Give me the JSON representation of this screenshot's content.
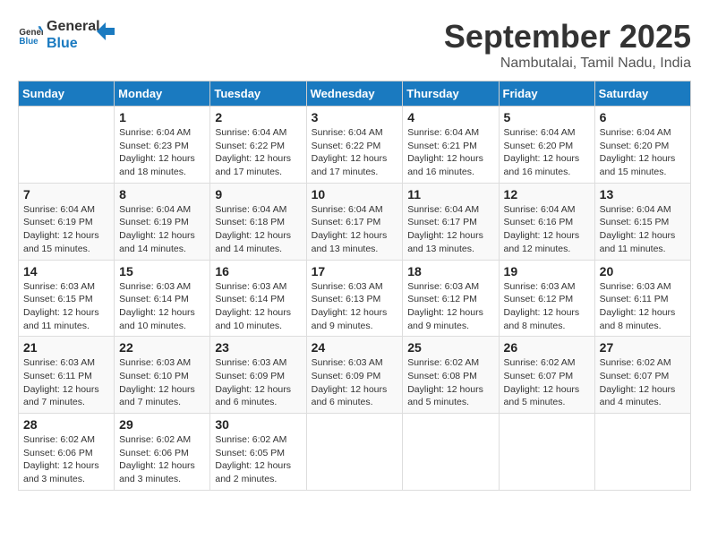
{
  "logo": {
    "line1": "General",
    "line2": "Blue"
  },
  "title": "September 2025",
  "location": "Nambutalai, Tamil Nadu, India",
  "weekdays": [
    "Sunday",
    "Monday",
    "Tuesday",
    "Wednesday",
    "Thursday",
    "Friday",
    "Saturday"
  ],
  "weeks": [
    [
      {
        "day": "",
        "info": ""
      },
      {
        "day": "1",
        "info": "Sunrise: 6:04 AM\nSunset: 6:23 PM\nDaylight: 12 hours\nand 18 minutes."
      },
      {
        "day": "2",
        "info": "Sunrise: 6:04 AM\nSunset: 6:22 PM\nDaylight: 12 hours\nand 17 minutes."
      },
      {
        "day": "3",
        "info": "Sunrise: 6:04 AM\nSunset: 6:22 PM\nDaylight: 12 hours\nand 17 minutes."
      },
      {
        "day": "4",
        "info": "Sunrise: 6:04 AM\nSunset: 6:21 PM\nDaylight: 12 hours\nand 16 minutes."
      },
      {
        "day": "5",
        "info": "Sunrise: 6:04 AM\nSunset: 6:20 PM\nDaylight: 12 hours\nand 16 minutes."
      },
      {
        "day": "6",
        "info": "Sunrise: 6:04 AM\nSunset: 6:20 PM\nDaylight: 12 hours\nand 15 minutes."
      }
    ],
    [
      {
        "day": "7",
        "info": "Sunrise: 6:04 AM\nSunset: 6:19 PM\nDaylight: 12 hours\nand 15 minutes."
      },
      {
        "day": "8",
        "info": "Sunrise: 6:04 AM\nSunset: 6:19 PM\nDaylight: 12 hours\nand 14 minutes."
      },
      {
        "day": "9",
        "info": "Sunrise: 6:04 AM\nSunset: 6:18 PM\nDaylight: 12 hours\nand 14 minutes."
      },
      {
        "day": "10",
        "info": "Sunrise: 6:04 AM\nSunset: 6:17 PM\nDaylight: 12 hours\nand 13 minutes."
      },
      {
        "day": "11",
        "info": "Sunrise: 6:04 AM\nSunset: 6:17 PM\nDaylight: 12 hours\nand 13 minutes."
      },
      {
        "day": "12",
        "info": "Sunrise: 6:04 AM\nSunset: 6:16 PM\nDaylight: 12 hours\nand 12 minutes."
      },
      {
        "day": "13",
        "info": "Sunrise: 6:04 AM\nSunset: 6:15 PM\nDaylight: 12 hours\nand 11 minutes."
      }
    ],
    [
      {
        "day": "14",
        "info": "Sunrise: 6:03 AM\nSunset: 6:15 PM\nDaylight: 12 hours\nand 11 minutes."
      },
      {
        "day": "15",
        "info": "Sunrise: 6:03 AM\nSunset: 6:14 PM\nDaylight: 12 hours\nand 10 minutes."
      },
      {
        "day": "16",
        "info": "Sunrise: 6:03 AM\nSunset: 6:14 PM\nDaylight: 12 hours\nand 10 minutes."
      },
      {
        "day": "17",
        "info": "Sunrise: 6:03 AM\nSunset: 6:13 PM\nDaylight: 12 hours\nand 9 minutes."
      },
      {
        "day": "18",
        "info": "Sunrise: 6:03 AM\nSunset: 6:12 PM\nDaylight: 12 hours\nand 9 minutes."
      },
      {
        "day": "19",
        "info": "Sunrise: 6:03 AM\nSunset: 6:12 PM\nDaylight: 12 hours\nand 8 minutes."
      },
      {
        "day": "20",
        "info": "Sunrise: 6:03 AM\nSunset: 6:11 PM\nDaylight: 12 hours\nand 8 minutes."
      }
    ],
    [
      {
        "day": "21",
        "info": "Sunrise: 6:03 AM\nSunset: 6:11 PM\nDaylight: 12 hours\nand 7 minutes."
      },
      {
        "day": "22",
        "info": "Sunrise: 6:03 AM\nSunset: 6:10 PM\nDaylight: 12 hours\nand 7 minutes."
      },
      {
        "day": "23",
        "info": "Sunrise: 6:03 AM\nSunset: 6:09 PM\nDaylight: 12 hours\nand 6 minutes."
      },
      {
        "day": "24",
        "info": "Sunrise: 6:03 AM\nSunset: 6:09 PM\nDaylight: 12 hours\nand 6 minutes."
      },
      {
        "day": "25",
        "info": "Sunrise: 6:02 AM\nSunset: 6:08 PM\nDaylight: 12 hours\nand 5 minutes."
      },
      {
        "day": "26",
        "info": "Sunrise: 6:02 AM\nSunset: 6:07 PM\nDaylight: 12 hours\nand 5 minutes."
      },
      {
        "day": "27",
        "info": "Sunrise: 6:02 AM\nSunset: 6:07 PM\nDaylight: 12 hours\nand 4 minutes."
      }
    ],
    [
      {
        "day": "28",
        "info": "Sunrise: 6:02 AM\nSunset: 6:06 PM\nDaylight: 12 hours\nand 3 minutes."
      },
      {
        "day": "29",
        "info": "Sunrise: 6:02 AM\nSunset: 6:06 PM\nDaylight: 12 hours\nand 3 minutes."
      },
      {
        "day": "30",
        "info": "Sunrise: 6:02 AM\nSunset: 6:05 PM\nDaylight: 12 hours\nand 2 minutes."
      },
      {
        "day": "",
        "info": ""
      },
      {
        "day": "",
        "info": ""
      },
      {
        "day": "",
        "info": ""
      },
      {
        "day": "",
        "info": ""
      }
    ]
  ]
}
